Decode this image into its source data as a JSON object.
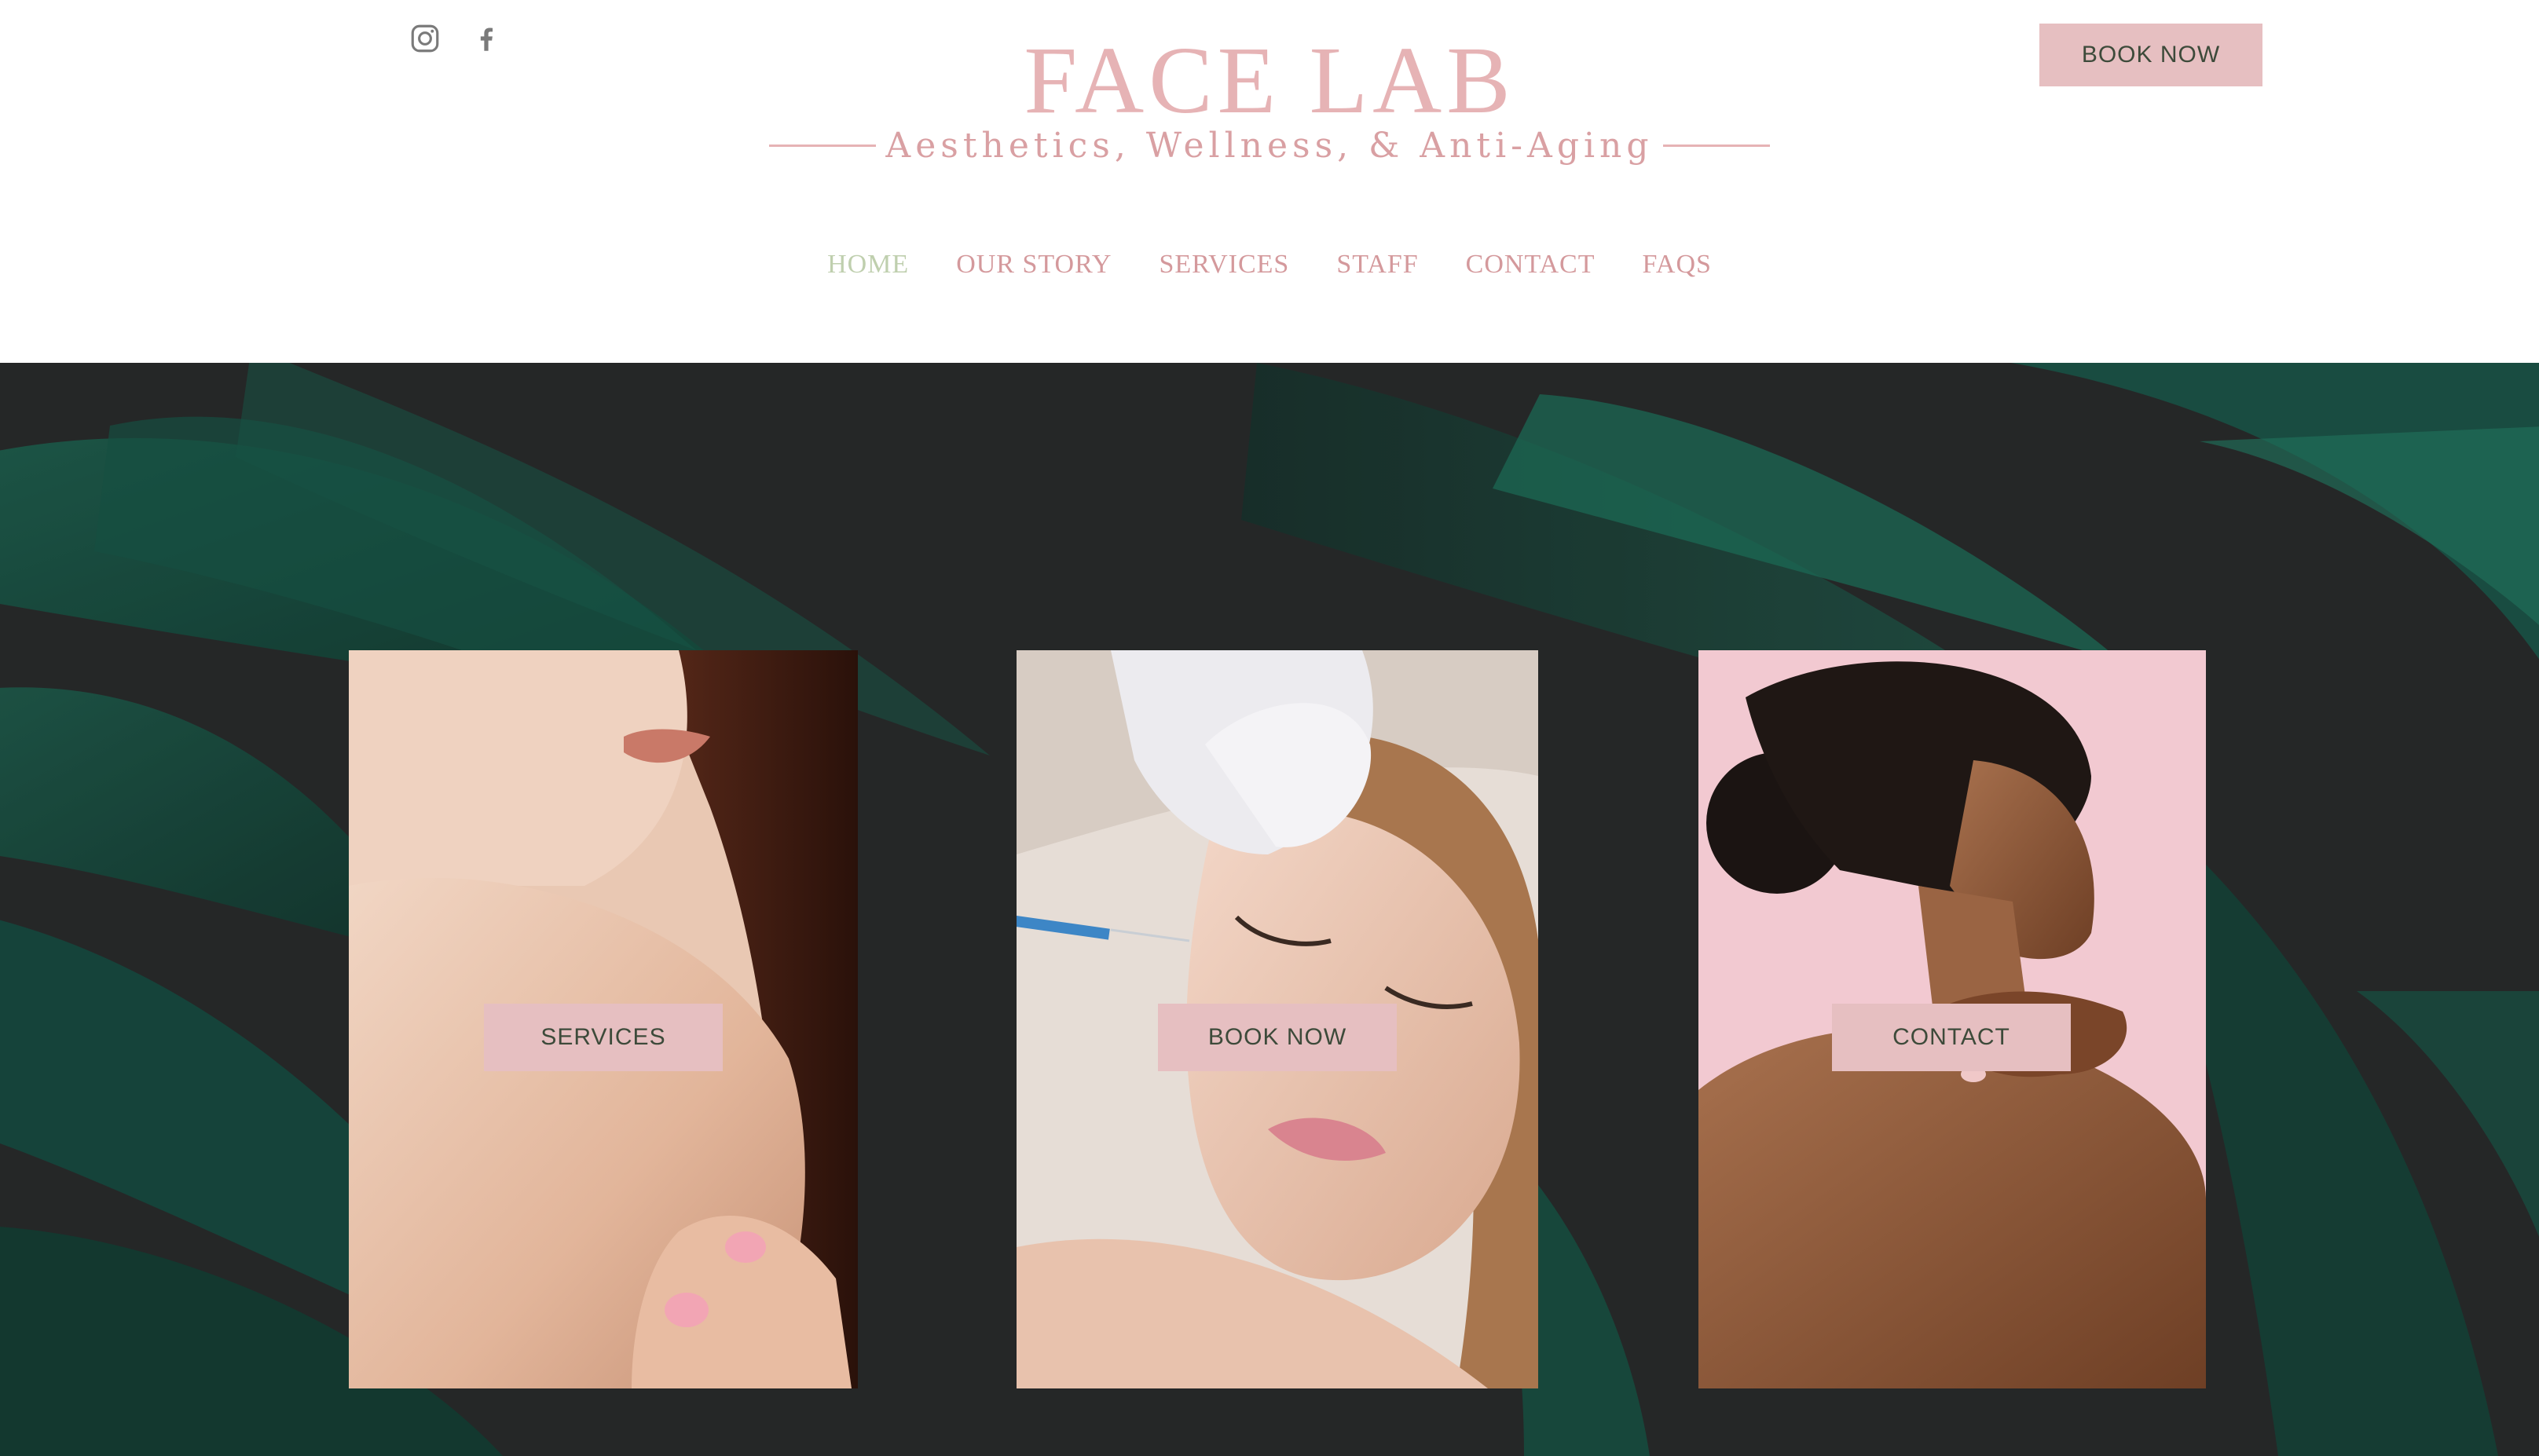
{
  "brand": {
    "title": "FACE LAB",
    "tagline": "Aesthetics, Wellness, & Anti-Aging"
  },
  "header": {
    "book_now_label": "BOOK NOW",
    "social": [
      "instagram-icon",
      "facebook-icon"
    ]
  },
  "nav": {
    "items": [
      {
        "label": "HOME",
        "active": true
      },
      {
        "label": "OUR STORY",
        "active": false
      },
      {
        "label": "SERVICES",
        "active": false
      },
      {
        "label": "STAFF",
        "active": false
      },
      {
        "label": "CONTACT",
        "active": false
      },
      {
        "label": "FAQS",
        "active": false
      }
    ]
  },
  "cards": [
    {
      "button_label": "SERVICES"
    },
    {
      "button_label": "BOOK NOW"
    },
    {
      "button_label": "CONTACT"
    }
  ],
  "colors": {
    "brand_pink": "#e6b3b5",
    "button_pink": "#e6bfc1",
    "nav_active": "#bfcfae",
    "hero_background": "#2b2d2d",
    "leaf_green": "#1f6b57"
  }
}
